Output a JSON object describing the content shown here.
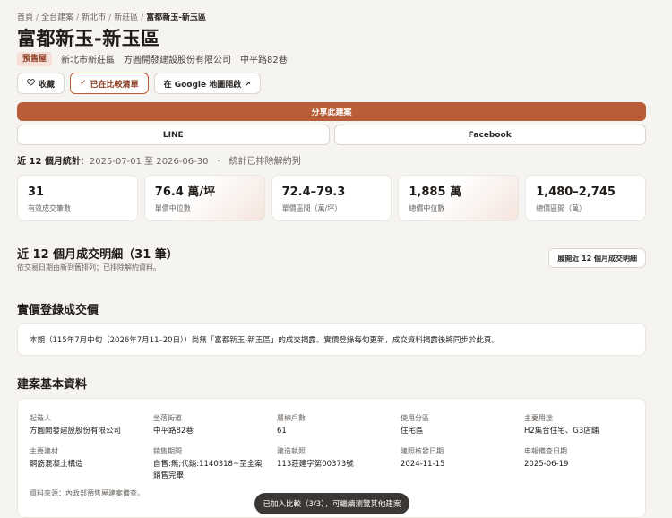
{
  "breadcrumb": {
    "items": [
      "首頁",
      "全台建案",
      "新北市",
      "新莊區"
    ],
    "current": "富都新玉-新玉區"
  },
  "page_title": "富都新玉-新玉區",
  "meta": {
    "badge": "預售屋",
    "location": "新北市新莊區",
    "developer": "方圓開發建設股份有限公司",
    "address": "中平路82巷"
  },
  "actions": {
    "favorite": "收藏",
    "compare": "已在比較清單",
    "map": "在 Google 地圖開啟 ↗"
  },
  "icons": {
    "favorite": "heart-icon",
    "compare": "check-icon"
  },
  "share": {
    "label": "分享此建案",
    "line": "LINE",
    "facebook": "Facebook"
  },
  "stats_line": {
    "bold": "近 12 個月統計",
    "range": "：2025-07-01 至 2026-06-30　·　統計已排除解約列"
  },
  "stats": [
    {
      "value": "31",
      "label": "有效成交筆數"
    },
    {
      "value": "76.4 萬/坪",
      "label": "單價中位數"
    },
    {
      "value": "72.4–79.3",
      "label": "單價區間（萬/坪）"
    },
    {
      "value": "1,885 萬",
      "label": "總價中位數"
    },
    {
      "value": "1,480–2,745",
      "label": "總價區間（萬）"
    }
  ],
  "transactions": {
    "title": "近 12 個月成交明細（31 筆）",
    "subtitle": "依交易日期由新到舊排列；已排除解約資料。",
    "expand_label": "展開近 12 個月成交明細"
  },
  "real_price": {
    "title": "實價登錄成交價",
    "notice": "本期（115年7月中旬（2026年7月11–20日））尚無「富都新玉-新玉區」的成交揭露。實價登錄每旬更新，成交資料揭露後將同步於此頁。"
  },
  "basic_info": {
    "title": "建案基本資料",
    "fields": [
      {
        "key": "起造人",
        "value": "方圓開發建設股份有限公司"
      },
      {
        "key": "坐落街道",
        "value": "中平路82巷"
      },
      {
        "key": "層棟戶數",
        "value": "61"
      },
      {
        "key": "使用分區",
        "value": "住宅區"
      },
      {
        "key": "主要用途",
        "value": "H2集合住宅、G3店鋪"
      },
      {
        "key": "主要建材",
        "value": "鋼筋混凝土構造"
      },
      {
        "key": "銷售期間",
        "value": "自售:無;代銷:1140318~至全案銷售完畢;"
      },
      {
        "key": "建造執照",
        "value": "113莊建字第00373號"
      },
      {
        "key": "建照核發日期",
        "value": "2024-11-15"
      },
      {
        "key": "申報備查日期",
        "value": "2025-06-19"
      }
    ],
    "source": "資料來源：內政部預售屋建案備查。"
  },
  "toast": "已加入比較（3/3），可繼續瀏覽其他建案",
  "colors": {
    "accent": "#b85d37",
    "background": "#f6f4f1",
    "badge_bg": "#f5dfd7"
  }
}
